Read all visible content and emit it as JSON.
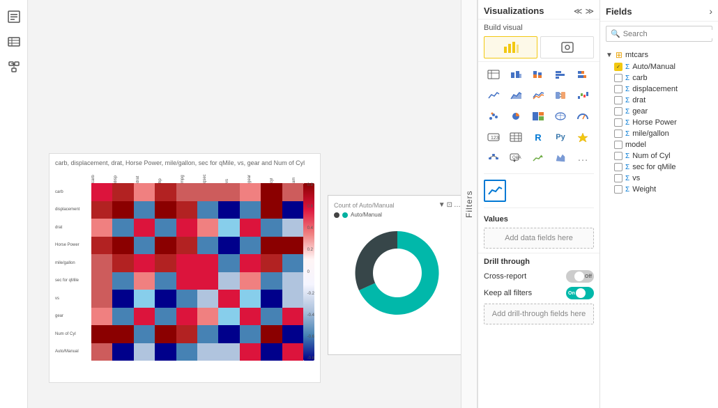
{
  "sidebar": {
    "icons": [
      {
        "name": "report-icon",
        "glyph": "⊞",
        "label": "Report"
      },
      {
        "name": "data-icon",
        "glyph": "⊟",
        "label": "Data"
      },
      {
        "name": "model-icon",
        "glyph": "⊠",
        "label": "Model"
      }
    ]
  },
  "filters_panel": {
    "label": "Filters"
  },
  "viz_panel": {
    "title": "Visualizations",
    "build_visual_label": "Build visual",
    "expand_icon": "≫",
    "collapse_icon": "≪",
    "values_section": "Values",
    "add_data_fields": "Add data fields here",
    "drill_through_label": "Drill through",
    "cross_report_label": "Cross-report",
    "cross_report_state": "Off",
    "keep_all_filters_label": "Keep all filters",
    "keep_all_filters_state": "On",
    "add_drill_fields": "Add drill-through fields here"
  },
  "fields_panel": {
    "title": "Fields",
    "expand_icon": "›",
    "search_placeholder": "Search",
    "table": {
      "name": "mtcars",
      "fields": [
        {
          "label": "Auto/Manual",
          "has_sigma": true,
          "checked": true
        },
        {
          "label": "carb",
          "has_sigma": true,
          "checked": false
        },
        {
          "label": "displacement",
          "has_sigma": true,
          "checked": false
        },
        {
          "label": "drat",
          "has_sigma": true,
          "checked": false
        },
        {
          "label": "gear",
          "has_sigma": true,
          "checked": false
        },
        {
          "label": "Horse Power",
          "has_sigma": true,
          "checked": false
        },
        {
          "label": "mile/gallon",
          "has_sigma": true,
          "checked": false
        },
        {
          "label": "model",
          "has_sigma": false,
          "checked": false
        },
        {
          "label": "Num of Cyl",
          "has_sigma": true,
          "checked": false
        },
        {
          "label": "sec for qMile",
          "has_sigma": true,
          "checked": false
        },
        {
          "label": "vs",
          "has_sigma": true,
          "checked": false
        },
        {
          "label": "Weight",
          "has_sigma": true,
          "checked": false
        }
      ]
    }
  },
  "heatmap": {
    "title": "carb, displacement, drat, Horse Power, mile/gallon, sec for qMile, vs, gear and Num of Cyl",
    "scale_values": [
      "0.8",
      "0.6",
      "0.4",
      "0.2",
      "0",
      "-0.2",
      "-0.4",
      "-0.6",
      "-0.8"
    ]
  },
  "donut_chart": {
    "title": "Count of Auto/Manual",
    "legend_label": "Auto/Manual",
    "legend_dot1": "teal",
    "legend_dot2": "dark"
  }
}
